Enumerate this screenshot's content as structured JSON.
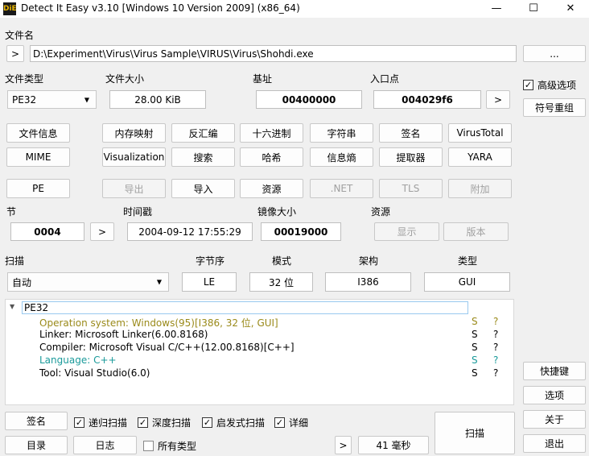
{
  "window": {
    "title": "Detect It Easy v3.10 [Windows 10 Version 2009] (x86_64)",
    "minimize": "—",
    "maximize": "☐",
    "close": "✕",
    "icon_text": "DiE"
  },
  "file": {
    "label": "文件名",
    "browse_prev": ">",
    "path": "D:\\Experiment\\Virus\\Virus Sample\\VIRUS\\Virus\\Shohdi.exe",
    "browse": "..."
  },
  "info": {
    "type_label": "文件类型",
    "type_value": "PE32",
    "size_label": "文件大小",
    "size_value": "28.00 KiB",
    "base_label": "基址",
    "base_value": "00400000",
    "entry_label": "入口点",
    "entry_value": "004029f6",
    "entry_go": ">"
  },
  "advanced": {
    "label": "高级选项",
    "checked": true,
    "symbol_button": "符号重组"
  },
  "tools_row1": [
    "文件信息",
    "内存映射",
    "反汇编",
    "十六进制",
    "字符串",
    "签名",
    "VirusTotal"
  ],
  "tools_row2": [
    "MIME",
    "Visualization",
    "搜索",
    "哈希",
    "信息熵",
    "提取器",
    "YARA"
  ],
  "pe_row": [
    {
      "label": "PE",
      "enabled": true
    },
    {
      "label": "导出",
      "enabled": false
    },
    {
      "label": "导入",
      "enabled": true
    },
    {
      "label": "资源",
      "enabled": true
    },
    {
      "label": ".NET",
      "enabled": false
    },
    {
      "label": "TLS",
      "enabled": false
    },
    {
      "label": "附加",
      "enabled": false
    }
  ],
  "sections": {
    "label": "节",
    "value": "0004",
    "go": ">",
    "timestamp_label": "时间戳",
    "timestamp": "2004-09-12 17:55:29",
    "image_size_label": "镜像大小",
    "image_size": "00019000",
    "resources_label": "资源",
    "show": "显示",
    "version": "版本"
  },
  "scan_opts": {
    "label": "扫描",
    "mode_value": "自动",
    "endian_label": "字节序",
    "endian": "LE",
    "bits_label": "模式",
    "bits": "32 位",
    "arch_label": "架构",
    "arch": "I386",
    "type_label": "类型",
    "type": "GUI"
  },
  "results": {
    "root": "PE32",
    "colors": {
      "os": "#9a8a1a",
      "lang": "#1a9a9a",
      "normal": "#000000"
    },
    "items": [
      {
        "text": "Operation system: Windows(95)[I386, 32 位, GUI]",
        "s": "S",
        "q": "?",
        "kind": "os"
      },
      {
        "text": "Linker: Microsoft Linker(6.00.8168)",
        "s": "S",
        "q": "?",
        "kind": "normal"
      },
      {
        "text": "Compiler: Microsoft Visual C/C++(12.00.8168)[C++]",
        "s": "S",
        "q": "?",
        "kind": "normal"
      },
      {
        "text": "Language: C++",
        "s": "S",
        "q": "?",
        "kind": "lang"
      },
      {
        "text": "Tool: Visual Studio(6.0)",
        "s": "S",
        "q": "?",
        "kind": "normal"
      }
    ]
  },
  "side": {
    "shortcuts": "快捷键",
    "options": "选项",
    "about": "关于",
    "exit": "退出"
  },
  "bottom": {
    "signatures": "签名",
    "recursive": "递归扫描",
    "deep": "深度扫描",
    "heuristic": "启发式扫描",
    "verbose": "详细",
    "directory": "目录",
    "log": "日志",
    "all_types": "所有类型",
    "more": ">",
    "time": "41 毫秒",
    "scan": "扫描"
  }
}
